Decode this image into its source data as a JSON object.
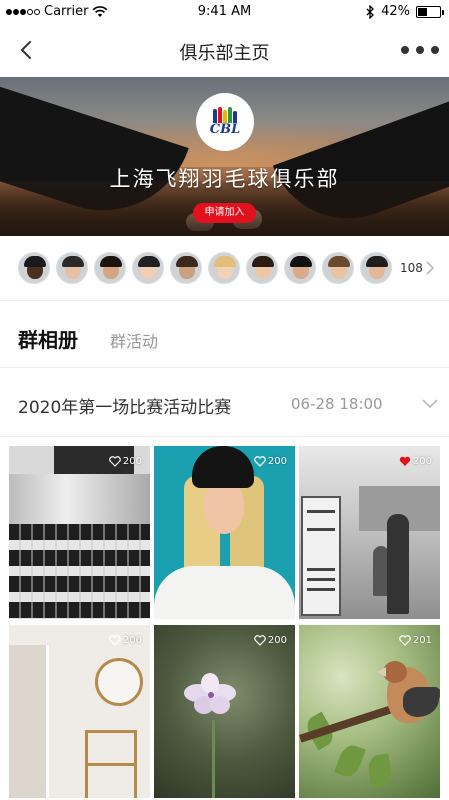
{
  "status_bar": {
    "carrier": "Carrier",
    "time": "9:41 AM",
    "battery_text": "42%",
    "battery_level": 0.42
  },
  "nav": {
    "title": "俱乐部主页",
    "back_icon": "chevron-left-icon",
    "more_icon": "more-dots-icon"
  },
  "club": {
    "logo_text": "CBL",
    "name": "上海飞翔羽毛球俱乐部",
    "join_label": "申请加入",
    "accent_color": "#e3101e"
  },
  "members": {
    "count": "108",
    "avatars": [
      {
        "skin": "#4a2f22",
        "hair": "#1a1a1a"
      },
      {
        "skin": "#e6c1a5",
        "hair": "#2a2a2a"
      },
      {
        "skin": "#d5a583",
        "hair": "#1c1410"
      },
      {
        "skin": "#f0cdb4",
        "hair": "#202020"
      },
      {
        "skin": "#caa083",
        "hair": "#3a2a1e"
      },
      {
        "skin": "#f3d0b8",
        "hair": "#e2bd7b"
      },
      {
        "skin": "#eec6a8",
        "hair": "#2b1d14"
      },
      {
        "skin": "#d9ab8b",
        "hair": "#111111"
      },
      {
        "skin": "#e9c3a2",
        "hair": "#6a4a2e"
      },
      {
        "skin": "#e2b898",
        "hair": "#1e1e1e"
      }
    ]
  },
  "tabs": {
    "active": "群相册",
    "inactive": "群活动"
  },
  "event": {
    "title": "2020年第一场比赛活动比赛",
    "time": "06-28 18:00"
  },
  "photos": [
    {
      "likes": "200",
      "liked": false
    },
    {
      "likes": "200",
      "liked": false
    },
    {
      "likes": "200",
      "liked": true
    },
    {
      "likes": "200",
      "liked": false
    },
    {
      "likes": "200",
      "liked": false
    },
    {
      "likes": "201",
      "liked": false
    }
  ],
  "colors": {
    "liked_heart": "#e3101e",
    "muted_text": "#999999"
  }
}
